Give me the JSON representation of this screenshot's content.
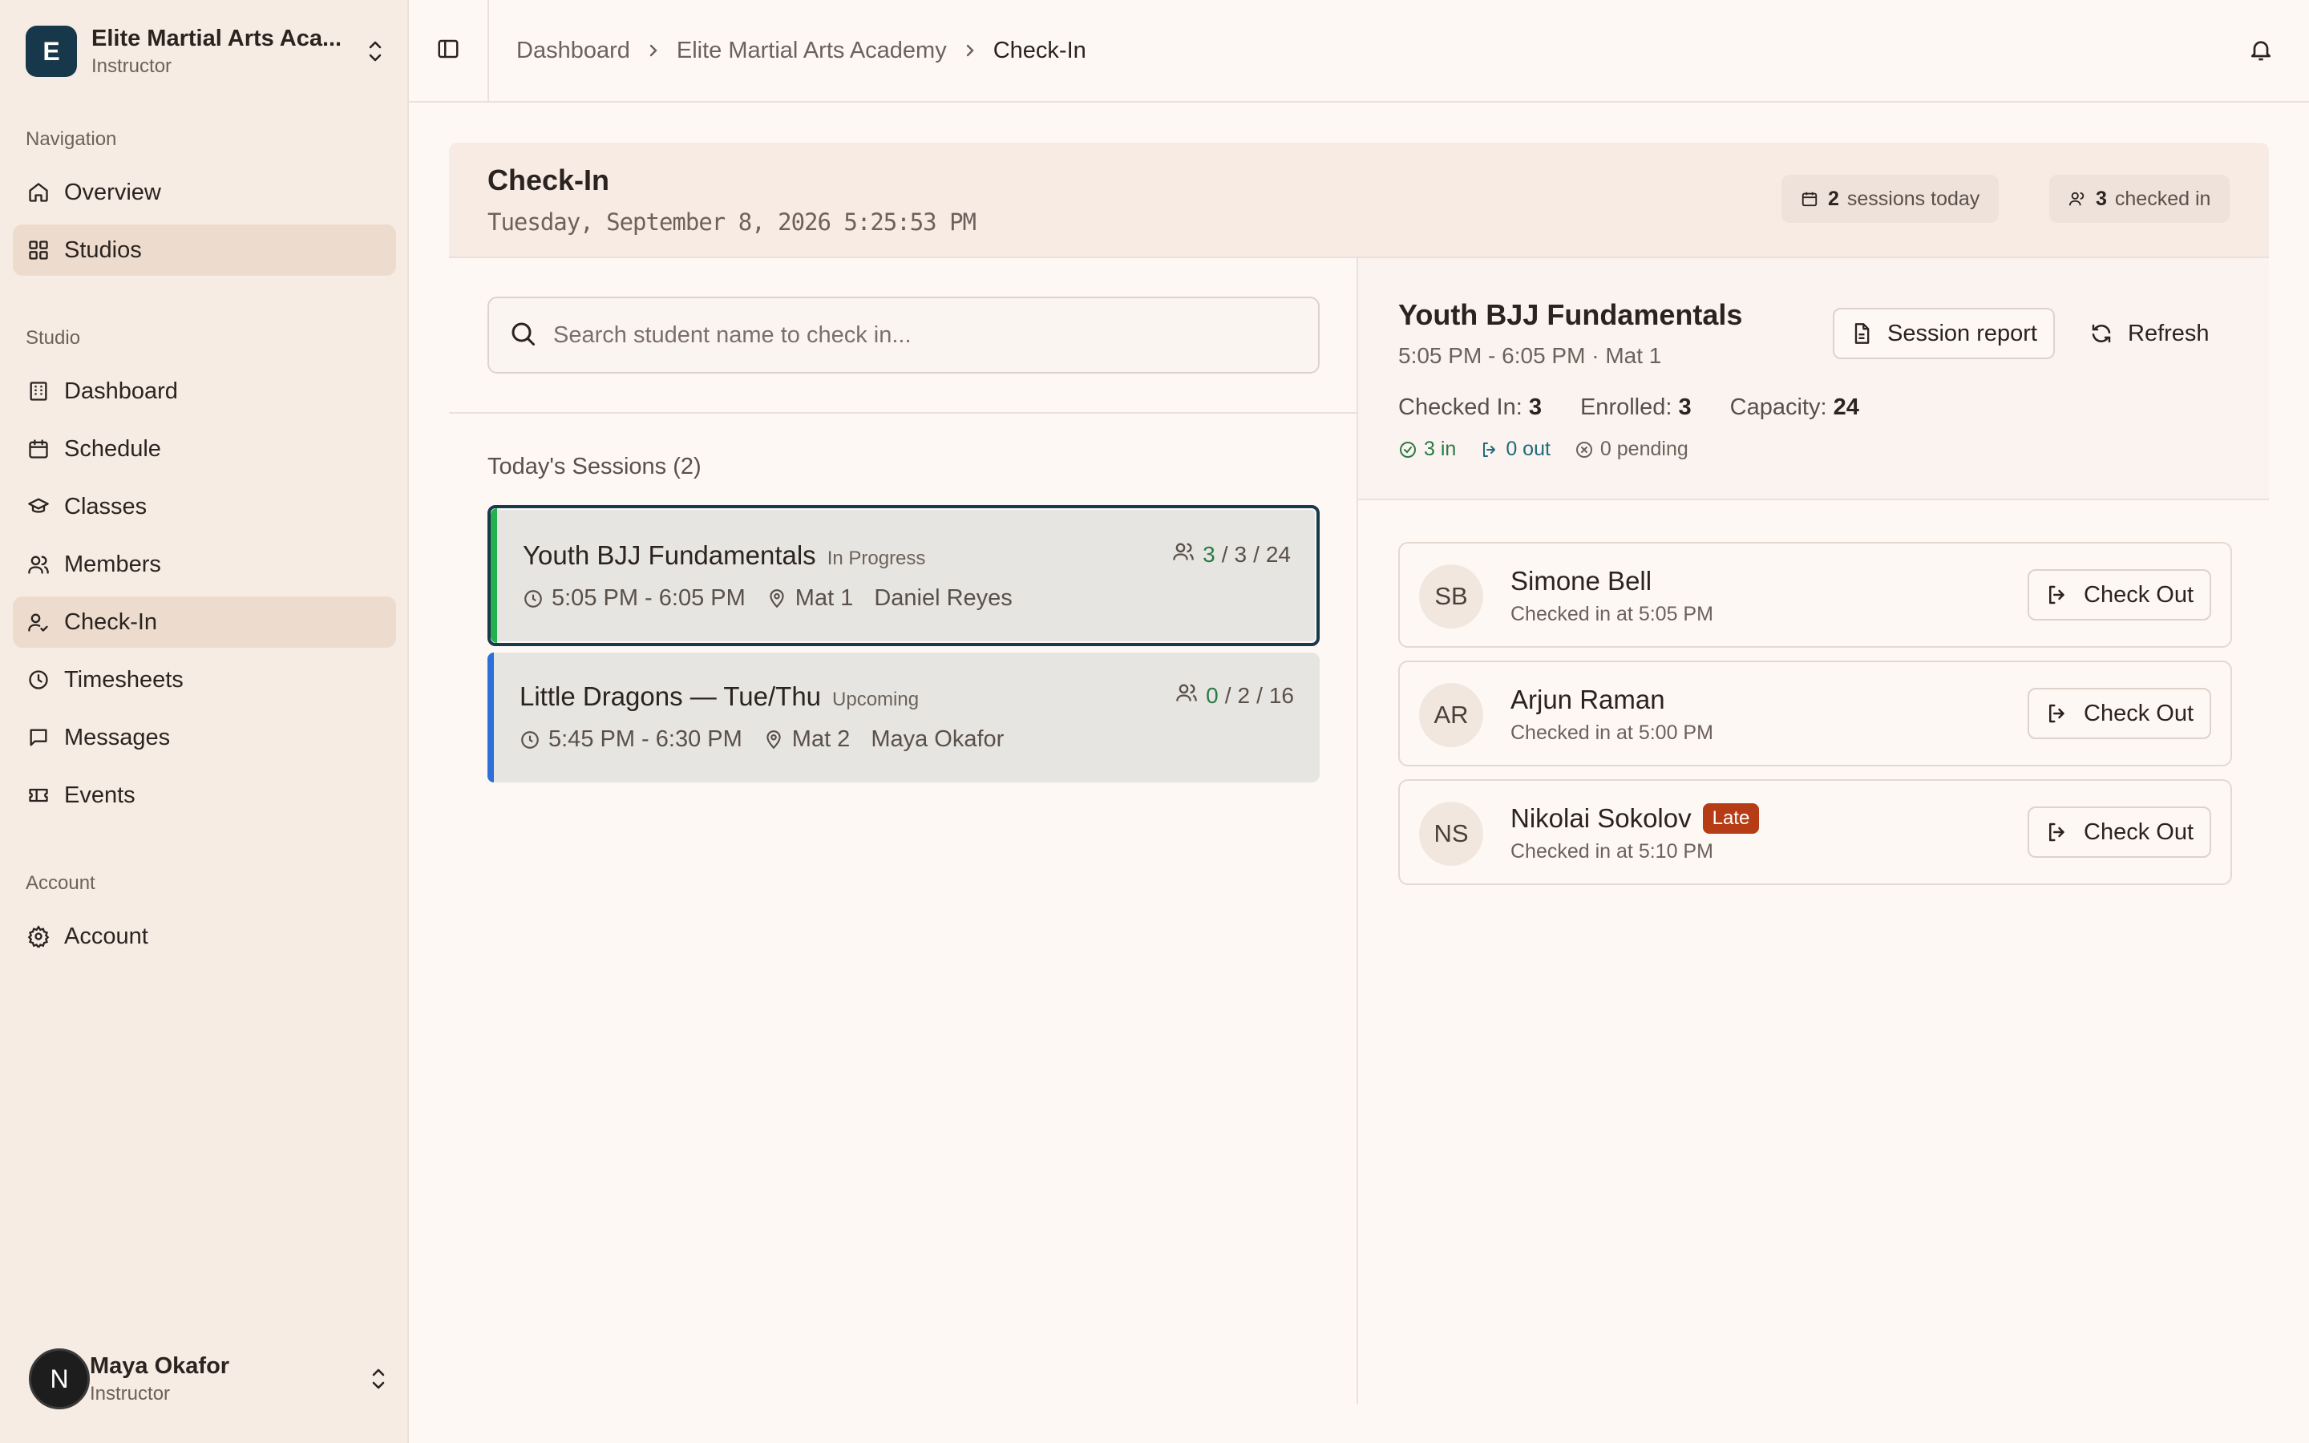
{
  "sidebar": {
    "org": {
      "logo_letter": "E",
      "name": "Elite Martial Arts Aca...",
      "role": "Instructor"
    },
    "sections": {
      "navigation": "Navigation",
      "studio": "Studio",
      "account": "Account"
    },
    "nav_items": [
      {
        "label": "Overview",
        "icon": "home-icon"
      },
      {
        "label": "Studios",
        "icon": "grid-icon",
        "active": true
      }
    ],
    "studio_items": [
      {
        "label": "Dashboard",
        "icon": "building-icon"
      },
      {
        "label": "Schedule",
        "icon": "calendar-icon"
      },
      {
        "label": "Classes",
        "icon": "graduation-cap-icon"
      },
      {
        "label": "Members",
        "icon": "users-icon"
      },
      {
        "label": "Check-In",
        "icon": "user-check-icon",
        "active": true
      },
      {
        "label": "Timesheets",
        "icon": "clock-icon"
      },
      {
        "label": "Messages",
        "icon": "message-icon"
      },
      {
        "label": "Events",
        "icon": "ticket-icon"
      }
    ],
    "account_items": [
      {
        "label": "Account",
        "icon": "gear-icon"
      }
    ],
    "user": {
      "initial": "N",
      "name": "Maya Okafor",
      "role": "Instructor"
    }
  },
  "topbar": {
    "breadcrumbs": [
      "Dashboard",
      "Elite Martial Arts Academy",
      "Check-In"
    ]
  },
  "header": {
    "title": "Check-In",
    "datetime": "Tuesday, September 8, 2026 5:25:53 PM",
    "chips": {
      "sessions_count": "2",
      "sessions_label": "sessions today",
      "checked_count": "3",
      "checked_label": "checked in"
    }
  },
  "search": {
    "placeholder": "Search student name to check in...",
    "value": ""
  },
  "sessions": {
    "title": "Today's Sessions (2)",
    "items": [
      {
        "name": "Youth BJJ Fundamentals",
        "status": "In Progress",
        "checked": "3",
        "enrolled": "3",
        "capacity": "24",
        "time": "5:05 PM - 6:05 PM",
        "location": "Mat 1",
        "instructor": "Daniel Reyes",
        "accent": "#22b14c"
      },
      {
        "name": "Little Dragons — Tue/Thu",
        "status": "Upcoming",
        "checked": "0",
        "enrolled": "2",
        "capacity": "16",
        "time": "5:45 PM - 6:30 PM",
        "location": "Mat 2",
        "instructor": "Maya Okafor",
        "accent": "#2f6fd8"
      }
    ]
  },
  "detail": {
    "title": "Youth BJJ Fundamentals",
    "subtitle": "5:05 PM - 6:05 PM · Mat 1",
    "report_label": "Session report",
    "refresh_label": "Refresh",
    "stats": {
      "checked_label": "Checked In:",
      "checked_value": "3",
      "enrolled_label": "Enrolled:",
      "enrolled_value": "3",
      "capacity_label": "Capacity:",
      "capacity_value": "24"
    },
    "flags": {
      "in": "3 in",
      "out": "0 out",
      "pending": "0 pending"
    },
    "students": [
      {
        "initials": "SB",
        "name": "Simone Bell",
        "time": "Checked in at 5:05 PM",
        "badge": "",
        "action": "Check Out"
      },
      {
        "initials": "AR",
        "name": "Arjun Raman",
        "time": "Checked in at 5:00 PM",
        "badge": "",
        "action": "Check Out"
      },
      {
        "initials": "NS",
        "name": "Nikolai Sokolov",
        "time": "Checked in at 5:10 PM",
        "badge": "Late",
        "action": "Check Out"
      }
    ]
  },
  "colors": {
    "brand": "#17384a",
    "accent_green": "#2a7a46",
    "accent_teal": "#1f6b7a",
    "late_badge": "#b53c14",
    "active_nav": "#eddccd"
  }
}
